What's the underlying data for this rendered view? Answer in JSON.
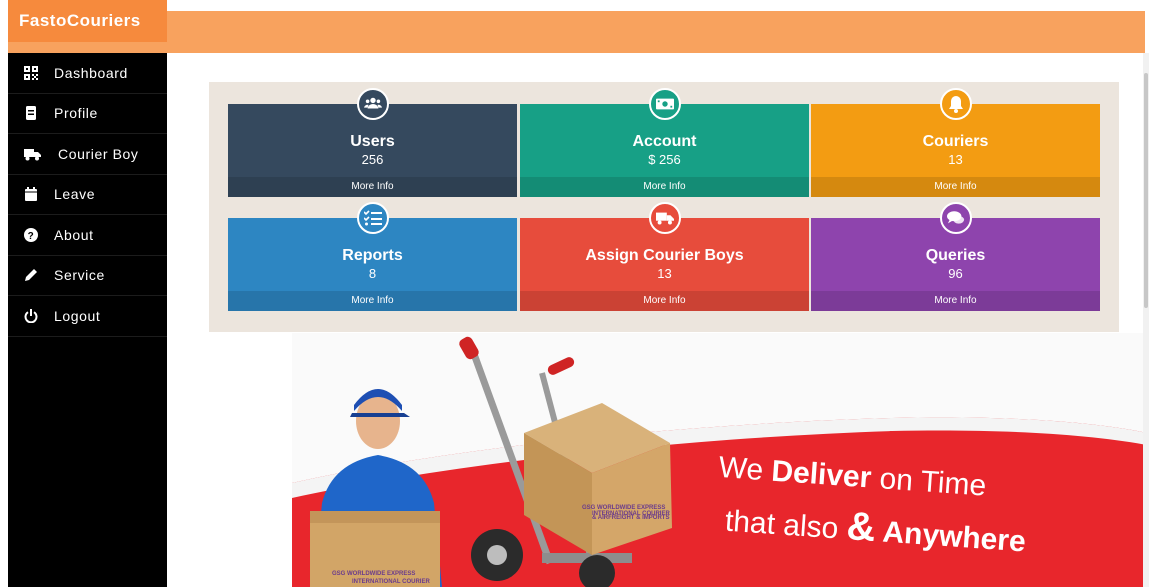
{
  "brand": "FastoCouriers",
  "colors": {
    "header": "#f8a25e",
    "brand_bg": "#f68a3d",
    "sidebar": "#000000"
  },
  "sidebar": {
    "items": [
      {
        "label": "Dashboard",
        "icon": "qr-grid-icon"
      },
      {
        "label": "Profile",
        "icon": "document-icon"
      },
      {
        "label": "Courier Boy",
        "icon": "truck-icon"
      },
      {
        "label": "Leave",
        "icon": "calendar-icon"
      },
      {
        "label": "About",
        "icon": "question-circle-icon"
      },
      {
        "label": "Service",
        "icon": "pencil-icon"
      },
      {
        "label": "Logout",
        "icon": "power-icon"
      }
    ]
  },
  "cards": [
    {
      "title": "Users",
      "value": "256",
      "more": "More Info",
      "icon": "users-icon",
      "color": "#35495e"
    },
    {
      "title": "Account",
      "value": "$ 256",
      "more": "More Info",
      "icon": "money-icon",
      "color": "#17a086"
    },
    {
      "title": "Couriers",
      "value": "13",
      "more": "More Info",
      "icon": "bell-icon",
      "color": "#f39c12"
    },
    {
      "title": "Reports",
      "value": "8",
      "more": "More Info",
      "icon": "checklist-icon",
      "color": "#2d86c2"
    },
    {
      "title": "Assign Courier Boys",
      "value": "13",
      "more": "More Info",
      "icon": "truck-icon",
      "color": "#e74c3c"
    },
    {
      "title": "Queries",
      "value": "96",
      "more": "More Info",
      "icon": "chat-icon",
      "color": "#8e44ad"
    }
  ],
  "banner": {
    "line1_a": "We ",
    "line1_b": "Deliver",
    "line1_c": " on Time",
    "line2_a": "that also ",
    "line2_b": "&",
    "line2_c": " Anywhere",
    "box_logo": "GSG WORLDWIDE EXPRESS",
    "box_logo_sub": "INTERNATIONAL COURIER",
    "box_logo_sub2": "& AIRFREIGHT & IMPORTS"
  }
}
